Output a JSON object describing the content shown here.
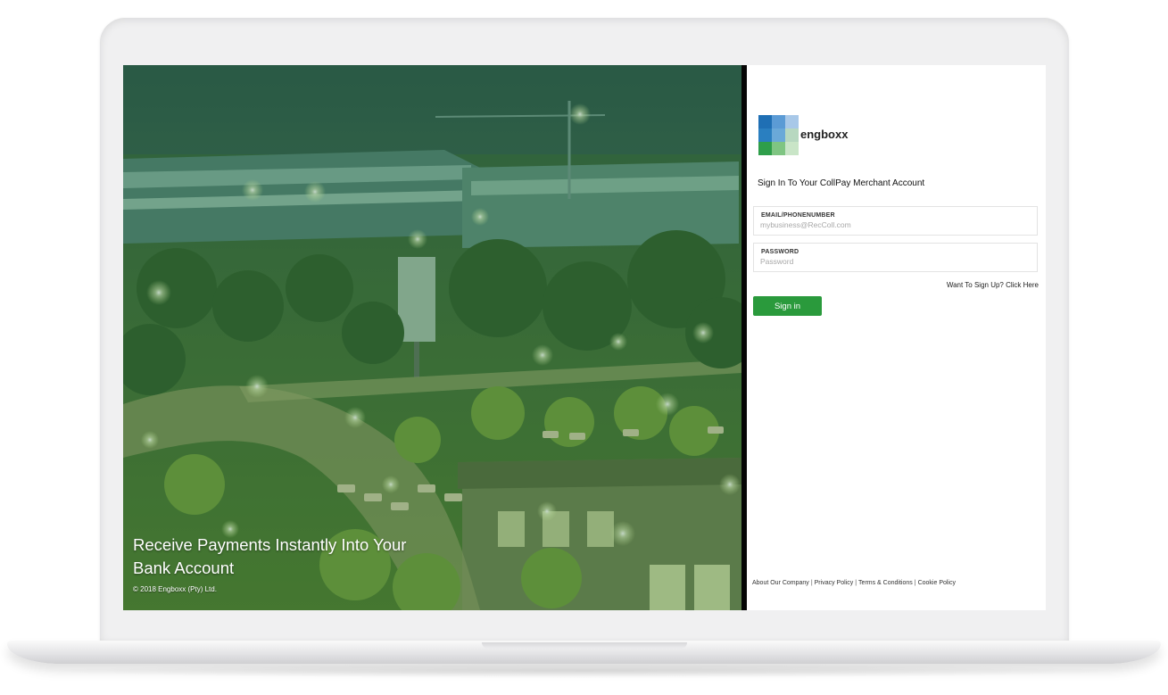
{
  "hero": {
    "headline": "Receive Payments Instantly Into Your Bank Account",
    "copyright": "© 2018 Engboxx (Pty) Ltd."
  },
  "brand": {
    "name": "engboxx",
    "logo_colors": [
      "#1f6fb4",
      "#5b9bd5",
      "#a8c8e8",
      "#2e9e4a",
      "#7fc582",
      "#c9e5c7"
    ]
  },
  "signin": {
    "title": "Sign In To Your CollPay Merchant Account",
    "email_label": "EMAIL/PHONENUMBER",
    "email_placeholder": "mybusiness@RecColl.com",
    "email_value": "",
    "password_label": "PASSWORD",
    "password_placeholder": "Password",
    "password_value": "",
    "signup_link": "Want To Sign Up? Click Here",
    "submit_label": "Sign in",
    "submit_color": "#2a9a3c"
  },
  "footer": {
    "links": [
      "About Our Company",
      "Privacy Policy",
      "Terms & Conditions",
      "Cookie Policy"
    ],
    "separator": "|"
  }
}
